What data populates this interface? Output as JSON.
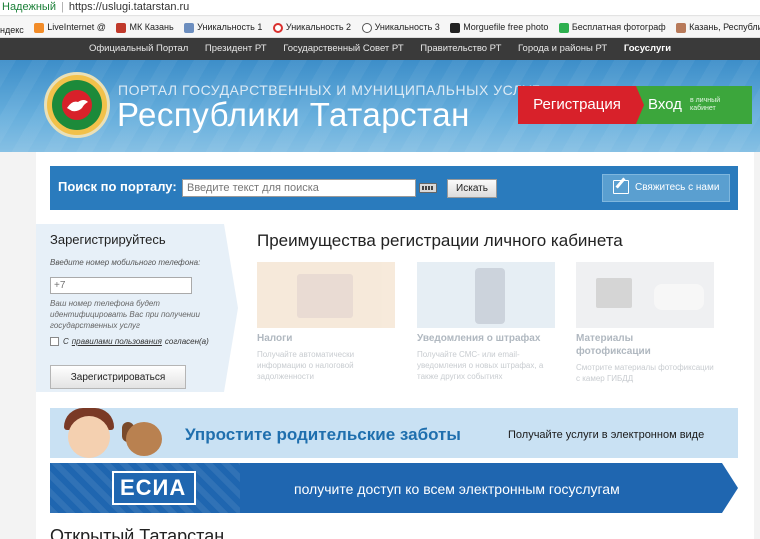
{
  "browser": {
    "secure_label": "Надежный",
    "url": "https://uslugi.tatarstan.ru"
  },
  "bookmarks": [
    {
      "label": "ндекс",
      "icon": "yandex-icon",
      "color": "#ffffff"
    },
    {
      "label": "LiveInternet @",
      "icon": "liveinternet-icon",
      "color": "#f28c28"
    },
    {
      "label": "МК Казань",
      "icon": "mk-icon",
      "color": "#c0392b"
    },
    {
      "label": "Уникальность 1",
      "icon": "page-icon",
      "color": "#6c8ebf"
    },
    {
      "label": "Уникальность 2",
      "icon": "copyright-icon",
      "color": "#d9302e"
    },
    {
      "label": "Уникальность 3",
      "icon": "eye-icon",
      "color": "#555555"
    },
    {
      "label": "Morguefile free photo",
      "icon": "morguefile-icon",
      "color": "#222222"
    },
    {
      "label": "Бесплатная фотограф",
      "icon": "px-icon",
      "color": "#2eaf4f"
    },
    {
      "label": "Казань, Республика Т",
      "icon": "page-icon",
      "color": "#b87a5a"
    }
  ],
  "topnav": [
    "Официальный Портал",
    "Президент РТ",
    "Государственный Совет РТ",
    "Правительство РТ",
    "Города и районы РТ",
    "Госуслуги"
  ],
  "header": {
    "line1": "ПОРТАЛ ГОСУДАРСТВЕННЫХ И МУНИЦИПАЛЬНЫХ УСЛУГ",
    "line2": "Республики Татарстан",
    "register": "Регистрация",
    "login": "Вход",
    "login_sub1": "в личный",
    "login_sub2": "кабинет"
  },
  "search": {
    "label": "Поиск по порталу:",
    "placeholder": "Введите текст для поиска",
    "button": "Искать",
    "contact": "Свяжитесь с нами"
  },
  "register_panel": {
    "title": "Зарегистрируйтесь",
    "hint": "Введите номер мобильного телефона:",
    "phone_placeholder": "+7",
    "note": "Ваш номер телефона будет идентифицировать Вас при получении государственных услуг",
    "agree_prefix": "С",
    "agree_link": "правилами пользования",
    "agree_suffix": "согласен(а)",
    "button": "Зарегистрироваться"
  },
  "advantages": {
    "title": "Преимущества регистрации личного кабинета",
    "items": [
      {
        "title": "Налоги",
        "title2": "",
        "text": "Получайте автоматически информацию о налоговой задолженности"
      },
      {
        "title": "Уведомления о штрафах",
        "title2": "",
        "text": "Получайте СМС- или email-уведомления о новых штрафах, а также других событиях"
      },
      {
        "title": "Материалы",
        "title2": "фотофиксации",
        "text": "Смотрите материалы фотофиксации с камер ГИБДД"
      }
    ]
  },
  "banner_parents": {
    "title": "Упростите родительские заботы",
    "subtitle": "Получайте услуги в электронном виде"
  },
  "banner_esia": {
    "logo": "ЕСИА",
    "text": "получите доступ ко всем электронным госуслугам"
  },
  "section_title": "Открытый Татарстан"
}
